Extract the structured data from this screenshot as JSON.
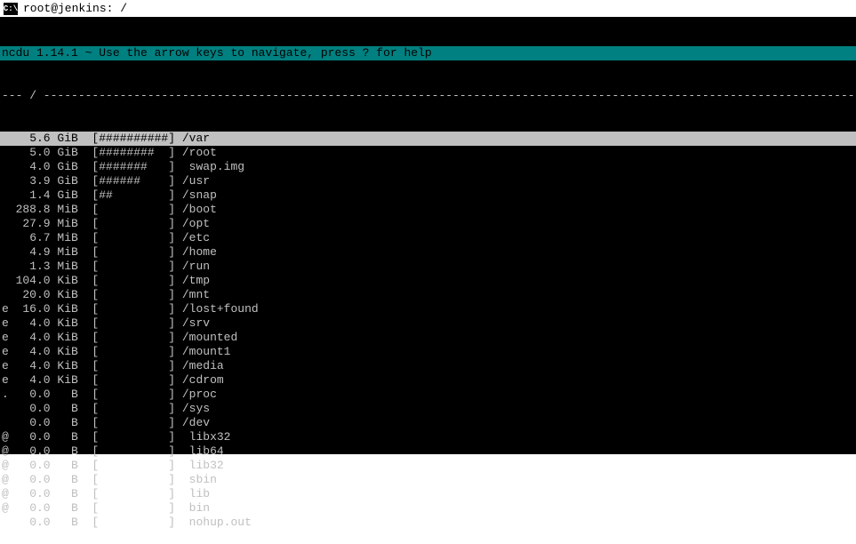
{
  "titlebar": {
    "icon_text": "C:\\",
    "title": "root@jenkins: /"
  },
  "header": "ncdu 1.14.1 ~ Use the arrow keys to navigate, press ? for help",
  "separator": "--- / ---------------------------------------------------------------------------------------------------------------------------",
  "rows": [
    {
      "prefix": " ",
      "size": "5.6",
      "unit": "GiB",
      "bar": "[##########]",
      "name": "/var",
      "selected": true
    },
    {
      "prefix": " ",
      "size": "5.0",
      "unit": "GiB",
      "bar": "[########  ]",
      "name": "/root",
      "selected": false
    },
    {
      "prefix": " ",
      "size": "4.0",
      "unit": "GiB",
      "bar": "[#######   ]",
      "name": " swap.img",
      "selected": false
    },
    {
      "prefix": " ",
      "size": "3.9",
      "unit": "GiB",
      "bar": "[######    ]",
      "name": "/usr",
      "selected": false
    },
    {
      "prefix": " ",
      "size": "1.4",
      "unit": "GiB",
      "bar": "[##        ]",
      "name": "/snap",
      "selected": false
    },
    {
      "prefix": " ",
      "size": "288.8",
      "unit": "MiB",
      "bar": "[          ]",
      "name": "/boot",
      "selected": false
    },
    {
      "prefix": " ",
      "size": "27.9",
      "unit": "MiB",
      "bar": "[          ]",
      "name": "/opt",
      "selected": false
    },
    {
      "prefix": " ",
      "size": "6.7",
      "unit": "MiB",
      "bar": "[          ]",
      "name": "/etc",
      "selected": false
    },
    {
      "prefix": " ",
      "size": "4.9",
      "unit": "MiB",
      "bar": "[          ]",
      "name": "/home",
      "selected": false
    },
    {
      "prefix": " ",
      "size": "1.3",
      "unit": "MiB",
      "bar": "[          ]",
      "name": "/run",
      "selected": false
    },
    {
      "prefix": " ",
      "size": "104.0",
      "unit": "KiB",
      "bar": "[          ]",
      "name": "/tmp",
      "selected": false
    },
    {
      "prefix": " ",
      "size": "20.0",
      "unit": "KiB",
      "bar": "[          ]",
      "name": "/mnt",
      "selected": false
    },
    {
      "prefix": "e",
      "size": "16.0",
      "unit": "KiB",
      "bar": "[          ]",
      "name": "/lost+found",
      "selected": false
    },
    {
      "prefix": "e",
      "size": "4.0",
      "unit": "KiB",
      "bar": "[          ]",
      "name": "/srv",
      "selected": false
    },
    {
      "prefix": "e",
      "size": "4.0",
      "unit": "KiB",
      "bar": "[          ]",
      "name": "/mounted",
      "selected": false
    },
    {
      "prefix": "e",
      "size": "4.0",
      "unit": "KiB",
      "bar": "[          ]",
      "name": "/mount1",
      "selected": false
    },
    {
      "prefix": "e",
      "size": "4.0",
      "unit": "KiB",
      "bar": "[          ]",
      "name": "/media",
      "selected": false
    },
    {
      "prefix": "e",
      "size": "4.0",
      "unit": "KiB",
      "bar": "[          ]",
      "name": "/cdrom",
      "selected": false
    },
    {
      "prefix": ".",
      "size": "0.0",
      "unit": "  B",
      "bar": "[          ]",
      "name": "/proc",
      "selected": false
    },
    {
      "prefix": " ",
      "size": "0.0",
      "unit": "  B",
      "bar": "[          ]",
      "name": "/sys",
      "selected": false
    },
    {
      "prefix": " ",
      "size": "0.0",
      "unit": "  B",
      "bar": "[          ]",
      "name": "/dev",
      "selected": false
    },
    {
      "prefix": "@",
      "size": "0.0",
      "unit": "  B",
      "bar": "[          ]",
      "name": " libx32",
      "selected": false
    },
    {
      "prefix": "@",
      "size": "0.0",
      "unit": "  B",
      "bar": "[          ]",
      "name": " lib64",
      "selected": false
    },
    {
      "prefix": "@",
      "size": "0.0",
      "unit": "  B",
      "bar": "[          ]",
      "name": " lib32",
      "selected": false
    },
    {
      "prefix": "@",
      "size": "0.0",
      "unit": "  B",
      "bar": "[          ]",
      "name": " sbin",
      "selected": false
    },
    {
      "prefix": "@",
      "size": "0.0",
      "unit": "  B",
      "bar": "[          ]",
      "name": " lib",
      "selected": false
    },
    {
      "prefix": "@",
      "size": "0.0",
      "unit": "  B",
      "bar": "[          ]",
      "name": " bin",
      "selected": false
    },
    {
      "prefix": " ",
      "size": "0.0",
      "unit": "  B",
      "bar": "[          ]",
      "name": " nohup.out",
      "selected": false
    }
  ]
}
